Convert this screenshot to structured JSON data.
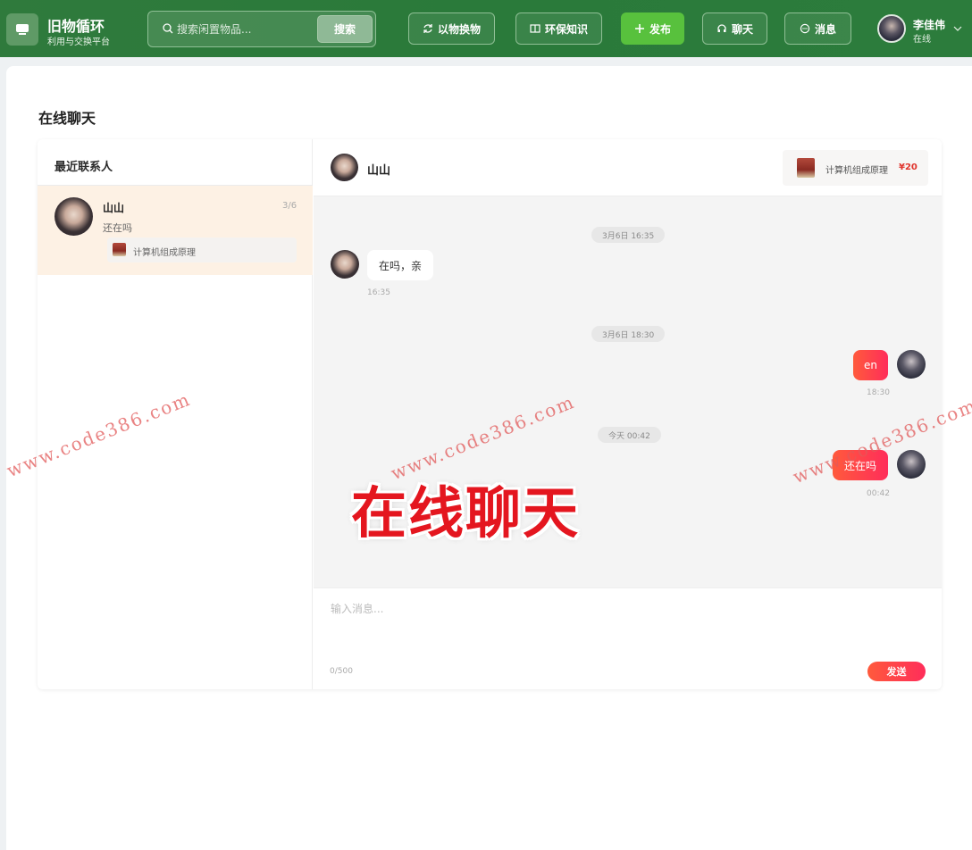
{
  "header": {
    "logo_title": "旧物循环",
    "logo_subtitle": "利用与交换平台",
    "search_placeholder": "搜索闲置物品...",
    "search_button": "搜索",
    "nav": {
      "exchange": "以物换物",
      "knowledge": "环保知识",
      "publish": "发布",
      "chat": "聊天",
      "messages": "消息"
    },
    "user": {
      "name": "李佳伟",
      "status": "在线"
    }
  },
  "page": {
    "title": "在线聊天"
  },
  "contacts": {
    "title": "最近联系人",
    "items": [
      {
        "name": "山山",
        "date": "3/6",
        "last_message": "还在吗",
        "product": "计算机组成原理"
      }
    ]
  },
  "conversation": {
    "name": "山山",
    "product": {
      "title": "计算机组成原理",
      "price": "¥20"
    },
    "messages": [
      {
        "divider": "3月6日 16:35",
        "text": "在吗，亲",
        "time": "16:35",
        "side": "left"
      },
      {
        "divider": "3月6日 18:30",
        "text": "en",
        "time": "18:30",
        "side": "right"
      },
      {
        "divider": "今天 00:42",
        "text": "还在吗",
        "time": "00:42",
        "side": "right"
      }
    ],
    "composer": {
      "placeholder": "输入消息...",
      "count": "0/500",
      "send": "发送"
    }
  },
  "overlay": {
    "caption": "在线聊天",
    "watermark": "www.code386.com"
  },
  "colors": {
    "header_green": "#2c7a3b",
    "publish_green": "#58c13d",
    "accent_red": "#ff2d5a",
    "price_red": "#e0342c",
    "selected_contact": "#fdf1e4"
  }
}
